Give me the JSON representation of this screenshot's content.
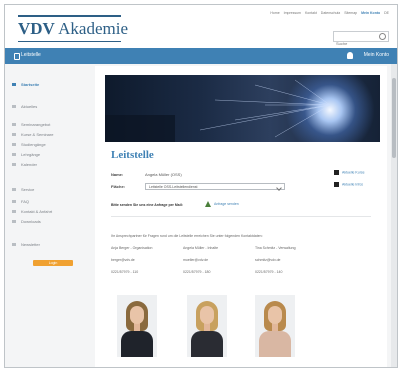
{
  "header": {
    "logo_bold": "VDV",
    "logo_rest": "Akademie",
    "top_links": [
      "Home",
      "Impressum",
      "Kontakt",
      "Datenschutz",
      "Sitemap",
      "Mein Konto",
      "DE"
    ],
    "search_placeholder": "Suche"
  },
  "bluebar": {
    "breadcrumb": "Leitstelle",
    "user_label": "Mein Konto"
  },
  "sidebar": {
    "items": [
      {
        "label": "Startseite",
        "active": true
      },
      {
        "label": "Aktuelles",
        "active": false
      },
      {
        "label": "Seminarangebot",
        "active": false
      },
      {
        "label": "Kurse & Seminare",
        "active": false
      },
      {
        "label": "Studiengänge",
        "active": false
      },
      {
        "label": "Lehrgänge",
        "active": false
      },
      {
        "label": "Kalender",
        "active": false
      },
      {
        "label": "Service",
        "active": false
      },
      {
        "label": "FAQ",
        "active": false
      },
      {
        "label": "Kontakt & Anfahrt",
        "active": false
      },
      {
        "label": "Downloads",
        "active": false
      },
      {
        "label": "Newsletter",
        "active": false
      }
    ],
    "button_label": "Login"
  },
  "main": {
    "title": "Leitstelle",
    "fields": [
      {
        "label": "Name:",
        "value": "Angela Müller (OSS)"
      },
      {
        "label": "Fläche:",
        "value": "Leitstelle OSS-Leitstellendienst"
      }
    ],
    "actions": [
      {
        "label": "Aktuelle Kurse"
      },
      {
        "label": "Aktuelle Infos"
      }
    ],
    "send_text": "Bitte senden Sie uns eine Anfrage per Mail:",
    "send_link": "Anfrage senden",
    "intro": "Ihr Ansprechpartner für Fragen rund um die Leitstelle erreichen Sie unter folgenden Kontaktdaten:",
    "contacts": [
      {
        "name": "Anja Berger - Organisation",
        "email": "berger@vdv.de",
        "phone": "0221/57979 - 110"
      },
      {
        "name": "Angela Müller - Inhalte",
        "email": "mueller@vdv.de",
        "phone": "0221/57979 - 180"
      },
      {
        "name": "Tina Schmitz - Verwaltung",
        "email": "schmitz@vdv.de",
        "phone": "0221/57979 - 140"
      }
    ]
  },
  "colors": {
    "brand_blue": "#3f81b4",
    "logo_blue": "#2d5f86",
    "accent_orange": "#f0a131"
  }
}
